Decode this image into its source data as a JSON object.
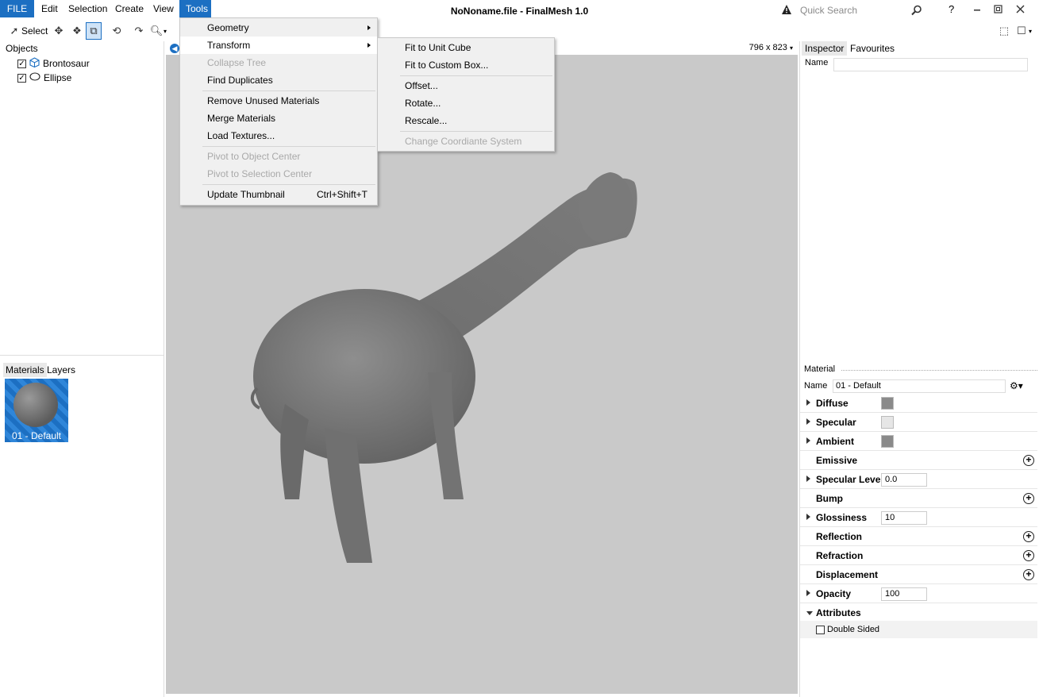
{
  "window": {
    "title": "NoNoname.file - FinalMesh 1.0"
  },
  "menubar": {
    "file": "FILE",
    "edit": "Edit",
    "selection": "Selection",
    "create": "Create",
    "view": "View",
    "tools": "Tools"
  },
  "search": {
    "placeholder": "Quick Search"
  },
  "toolbar": {
    "select_label": "Select"
  },
  "viewport": {
    "size_label": "796 x 823"
  },
  "objects_panel": {
    "title": "Objects",
    "items": [
      {
        "label": "Brontosaur",
        "checked": true,
        "icon": "cube-icon"
      },
      {
        "label": "Ellipse",
        "checked": true,
        "icon": "ellipse-icon"
      }
    ]
  },
  "materials_panel": {
    "tabs": [
      "Materials",
      "Layers"
    ],
    "items": [
      {
        "label": "01 - Default"
      }
    ]
  },
  "tools_menu": {
    "items": [
      {
        "label": "Geometry",
        "submenu": true
      },
      {
        "label": "Transform",
        "submenu": true
      },
      {
        "label": "Collapse Tree",
        "disabled": true
      },
      {
        "label": "Find Duplicates"
      },
      {
        "label": "Remove Unused Materials"
      },
      {
        "label": "Merge Materials"
      },
      {
        "label": "Load Textures..."
      },
      {
        "label": "Pivot to Object Center",
        "disabled": true
      },
      {
        "label": "Pivot to Selection Center",
        "disabled": true
      },
      {
        "label": "Update Thumbnail",
        "shortcut": "Ctrl+Shift+T"
      }
    ]
  },
  "transform_menu": {
    "items": [
      {
        "label": "Fit to Unit Cube"
      },
      {
        "label": "Fit to Custom Box..."
      },
      {
        "label": "Offset..."
      },
      {
        "label": "Rotate..."
      },
      {
        "label": "Rescale..."
      },
      {
        "label": "Change Coordiante System",
        "disabled": true
      }
    ]
  },
  "inspector": {
    "tabs": [
      "Inspector",
      "Favourites"
    ],
    "name_label": "Name",
    "material_header": "Material",
    "material_name_label": "Name",
    "material_name_value": "01 - Default",
    "properties": {
      "diffuse": "Diffuse",
      "specular": "Specular",
      "ambient": "Ambient",
      "emissive": "Emissive",
      "specular_level": "Specular Level",
      "specular_level_value": "0.0",
      "bump": "Bump",
      "glossiness": "Glossiness",
      "glossiness_value": "10",
      "reflection": "Reflection",
      "refraction": "Refraction",
      "displacement": "Displacement",
      "opacity": "Opacity",
      "opacity_value": "100",
      "attributes": "Attributes",
      "double_sided": "Double Sided"
    },
    "colors": {
      "diffuse": "#8a8a8a",
      "specular": "#e6e6e6",
      "ambient": "#8a8a8a"
    }
  },
  "colors": {
    "accent": "#1c6fc2",
    "viewport_bg": "#c9c9c9"
  }
}
